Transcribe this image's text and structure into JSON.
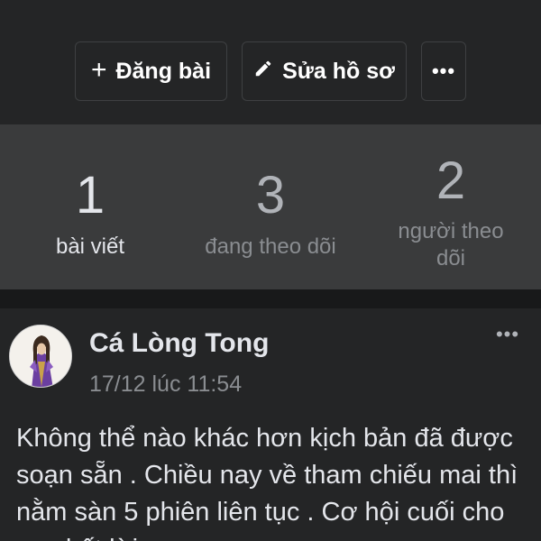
{
  "actions": {
    "post_label": "Đăng bài",
    "post_icon": "plus-icon",
    "edit_label": "Sửa hồ sơ",
    "edit_icon": "pencil-icon",
    "more_label": "•••"
  },
  "stats": [
    {
      "value": "1",
      "label": "bài viết"
    },
    {
      "value": "3",
      "label": "đang theo dõi"
    },
    {
      "value": "2",
      "label": "người theo dõi"
    }
  ],
  "post": {
    "author": "Cá Lòng Tong",
    "timestamp": "17/12 lúc 11:54",
    "more_label": "•••",
    "body": "Không thể nào khác hơn kịch bản đã được soạn sẵn . Chiều nay về tham chiếu mai thì nằm sàn 5 phiên liên tục . Cơ hội cuối cho ae chốt lời"
  },
  "colors": {
    "background": "#18191a",
    "card": "#242526",
    "stats_band": "#3a3b3c",
    "text_primary": "#e4e6eb",
    "text_secondary": "#8a8d91"
  }
}
